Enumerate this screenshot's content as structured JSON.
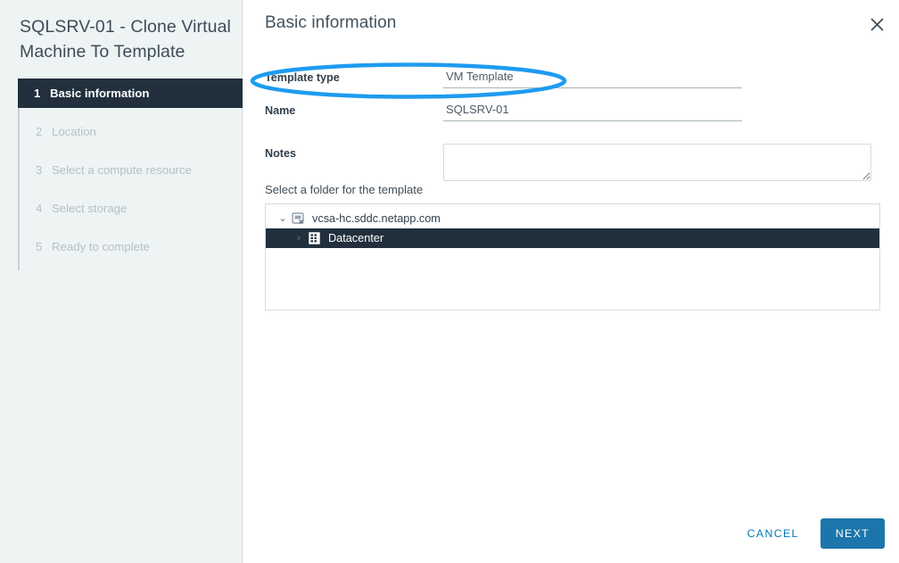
{
  "wizard": {
    "title": "SQLSRV-01 - Clone Virtual Machine To Template",
    "steps": [
      {
        "num": "1",
        "label": "Basic information",
        "state": "active"
      },
      {
        "num": "2",
        "label": "Location",
        "state": "inactive"
      },
      {
        "num": "3",
        "label": "Select a compute resource",
        "state": "inactive"
      },
      {
        "num": "4",
        "label": "Select storage",
        "state": "inactive"
      },
      {
        "num": "5",
        "label": "Ready to complete",
        "state": "inactive"
      }
    ]
  },
  "pane": {
    "title": "Basic information",
    "close_icon": "close-icon"
  },
  "form": {
    "template_type": {
      "label": "Template type",
      "value": "VM Template"
    },
    "name": {
      "label": "Name",
      "value": "SQLSRV-01",
      "placeholder": ""
    },
    "notes": {
      "label": "Notes",
      "value": "",
      "placeholder": ""
    }
  },
  "folder": {
    "heading": "Select a folder for the template",
    "tree": [
      {
        "label": "vcsa-hc.sddc.netapp.com",
        "level": 0,
        "twisty": "⌄",
        "expanded": true,
        "selected": false,
        "icon": "vcenter-server-icon"
      },
      {
        "label": "Datacenter",
        "level": 1,
        "twisty": "›",
        "expanded": false,
        "selected": true,
        "icon": "datacenter-icon"
      }
    ]
  },
  "footer": {
    "cancel_label": "CANCEL",
    "next_label": "NEXT"
  },
  "annotation": {
    "shape": "ellipse-highlight",
    "color": "#1e9bf0",
    "targets": "Template type row"
  },
  "colors": {
    "sidebar_bg": "#eef3f4",
    "active_step_bg": "#22303d",
    "selected_row_bg": "#22303d",
    "primary_button_bg": "#1d76ab",
    "link_blue": "#0079b8",
    "annotation_blue": "#1e9bf0"
  }
}
